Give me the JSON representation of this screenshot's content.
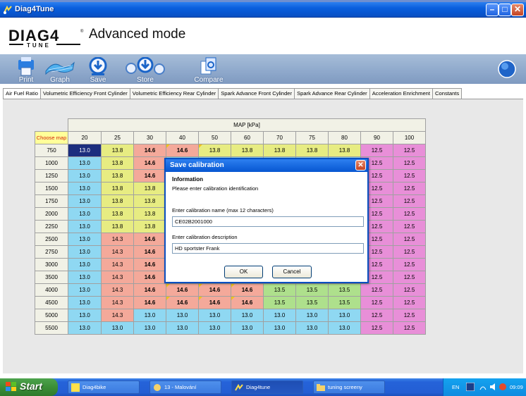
{
  "window": {
    "title": "Diag4Tune"
  },
  "header": {
    "logo_text": "DIAG4",
    "logo_sub": "TUNE",
    "title": "Advanced mode"
  },
  "toolbar": {
    "print": "Print",
    "graph": "Graph",
    "save": "Save",
    "store": "Store",
    "compare": "Compare"
  },
  "tabs": [
    "Air Fuel Ratio",
    "Volumetric Efficiency Front Cylinder",
    "Volumetric Efficiency Rear Cylinder",
    "Spark Advance Front Cylinder",
    "Spark Advance Rear Cylinder",
    "Acceleration Enrichment",
    "Constants"
  ],
  "grid": {
    "map_label": "MAP [kPa]",
    "choose": "Choose map",
    "columns": [
      "20",
      "25",
      "30",
      "40",
      "50",
      "60",
      "70",
      "75",
      "80",
      "90",
      "100"
    ],
    "rows": [
      "750",
      "1000",
      "1250",
      "1500",
      "1750",
      "2000",
      "2250",
      "2500",
      "2750",
      "3000",
      "3500",
      "4000",
      "4500",
      "5000",
      "5500"
    ],
    "values": [
      [
        "13.0",
        "13.8",
        "14.6",
        "14.6",
        "13.8",
        "13.8",
        "13.8",
        "13.8",
        "13.8",
        "12.5",
        "12.5"
      ],
      [
        "13.0",
        "13.8",
        "14.6",
        "",
        "",
        "",
        "",
        "",
        "",
        "12.5",
        "12.5"
      ],
      [
        "13.0",
        "13.8",
        "14.6",
        "",
        "",
        "",
        "",
        "",
        "",
        "12.5",
        "12.5"
      ],
      [
        "13.0",
        "13.8",
        "13.8",
        "",
        "",
        "",
        "",
        "",
        "",
        "12.5",
        "12.5"
      ],
      [
        "13.0",
        "13.8",
        "13.8",
        "",
        "",
        "",
        "",
        "",
        "",
        "12.5",
        "12.5"
      ],
      [
        "13.0",
        "13.8",
        "13.8",
        "",
        "",
        "",
        "",
        "",
        "",
        "12.5",
        "12.5"
      ],
      [
        "13.0",
        "13.8",
        "13.8",
        "",
        "",
        "",
        "",
        "",
        "",
        "12.5",
        "12.5"
      ],
      [
        "13.0",
        "14.3",
        "14.6",
        "",
        "",
        "",
        "",
        "",
        "",
        "12.5",
        "12.5"
      ],
      [
        "13.0",
        "14.3",
        "14.6",
        "",
        "",
        "",
        "",
        "",
        "",
        "12.5",
        "12.5"
      ],
      [
        "13.0",
        "14.3",
        "14.6",
        "",
        "",
        "",
        "",
        "",
        "",
        "12.5",
        "12.5"
      ],
      [
        "13.0",
        "14.3",
        "14.6",
        "",
        "",
        "",
        "",
        "",
        "",
        "12.5",
        "12.5"
      ],
      [
        "13.0",
        "14.3",
        "14.6",
        "14.6",
        "14.6",
        "14.6",
        "13.5",
        "13.5",
        "13.5",
        "12.5",
        "12.5"
      ],
      [
        "13.0",
        "14.3",
        "14.6",
        "14.6",
        "14.6",
        "14.6",
        "13.5",
        "13.5",
        "13.5",
        "12.5",
        "12.5"
      ],
      [
        "13.0",
        "14.3",
        "13.0",
        "13.0",
        "13.0",
        "13.0",
        "13.0",
        "13.0",
        "13.0",
        "12.5",
        "12.5"
      ],
      [
        "13.0",
        "13.0",
        "13.0",
        "13.0",
        "13.0",
        "13.0",
        "13.0",
        "13.0",
        "13.0",
        "12.5",
        "12.5"
      ]
    ],
    "classes": [
      [
        "sel",
        "c-yel",
        "c-salb",
        "c-salb flag",
        "c-yel flag",
        "c-yel",
        "c-yel",
        "c-yel",
        "c-yel",
        "c-pk",
        "c-pk"
      ],
      [
        "c-blue",
        "c-yel",
        "c-salb",
        "",
        "",
        "",
        "",
        "",
        "",
        "c-pk",
        "c-pk"
      ],
      [
        "c-blue",
        "c-yel",
        "c-salb",
        "",
        "",
        "",
        "",
        "",
        "",
        "c-pk",
        "c-pk"
      ],
      [
        "c-blue",
        "c-yel",
        "c-yel",
        "",
        "",
        "",
        "",
        "",
        "",
        "c-pk",
        "c-pk"
      ],
      [
        "c-blue",
        "c-yel",
        "c-yel",
        "",
        "",
        "",
        "",
        "",
        "",
        "c-pk",
        "c-pk"
      ],
      [
        "c-blue",
        "c-yel",
        "c-yel",
        "",
        "",
        "",
        "",
        "",
        "",
        "c-pk",
        "c-pk"
      ],
      [
        "c-blue",
        "c-yel",
        "c-yel",
        "",
        "",
        "",
        "",
        "",
        "",
        "c-pk",
        "c-pk"
      ],
      [
        "c-blue",
        "c-sal",
        "c-salb",
        "",
        "",
        "",
        "",
        "",
        "",
        "c-pk",
        "c-pk"
      ],
      [
        "c-blue",
        "c-sal",
        "c-salb",
        "",
        "",
        "",
        "",
        "",
        "",
        "c-pk",
        "c-pk"
      ],
      [
        "c-blue",
        "c-sal",
        "c-salb",
        "",
        "",
        "",
        "",
        "",
        "",
        "c-pk",
        "c-pk"
      ],
      [
        "c-blue",
        "c-sal",
        "c-salb",
        "",
        "",
        "",
        "",
        "",
        "",
        "c-pk",
        "c-pk"
      ],
      [
        "c-blue",
        "c-sal",
        "c-salb",
        "c-salb flag",
        "c-salb flag",
        "c-salb flag",
        "c-grn",
        "c-grn",
        "c-grn",
        "c-pk",
        "c-pk"
      ],
      [
        "c-blue",
        "c-sal",
        "c-salb",
        "c-salb flag",
        "c-salb flag",
        "c-salb flag",
        "c-grn",
        "c-grn",
        "c-grn",
        "c-pk",
        "c-pk"
      ],
      [
        "c-blue",
        "c-sal",
        "c-blue",
        "c-blue",
        "c-blue",
        "c-blue",
        "c-blue",
        "c-blue",
        "c-blue",
        "c-pk",
        "c-pk"
      ],
      [
        "c-blue",
        "c-blue",
        "c-blue",
        "c-blue",
        "c-blue",
        "c-blue",
        "c-blue",
        "c-blue",
        "c-blue",
        "c-pk",
        "c-pk"
      ]
    ]
  },
  "dialog": {
    "title": "Save calibration",
    "info_heading": "Information",
    "message": "Please enter calibration identification",
    "name_label": "Enter calibration name (max 12 characters)",
    "name_value": "CE02B2001000",
    "desc_label": "Enter calibration description",
    "desc_value": "HD sportster Frank",
    "ok": "OK",
    "cancel": "Cancel"
  },
  "taskbar": {
    "start": "Start",
    "tasks": [
      "Diag4bike",
      "13 - Malování",
      "Diag4tune",
      "tuning screeny"
    ],
    "lang": "EN",
    "clock": "09:09"
  },
  "colors": {
    "titlebar": "#0756d1",
    "toolbar": "#8ea8cb",
    "selected_cell": "#1c2d7e"
  }
}
